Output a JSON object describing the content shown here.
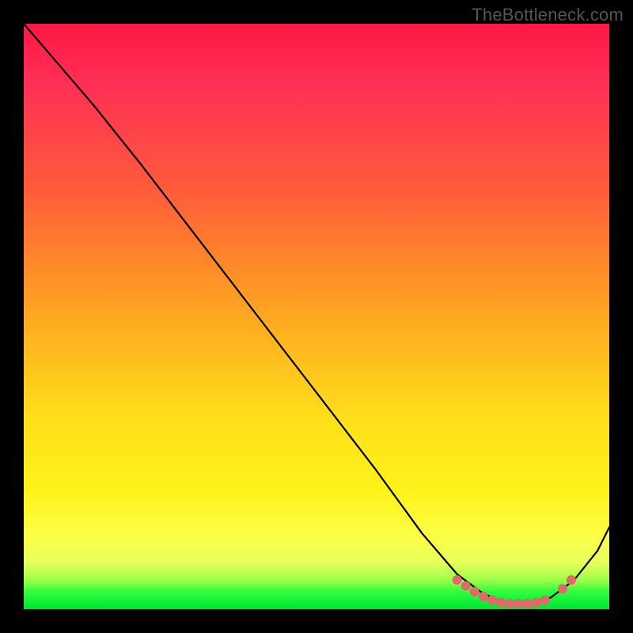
{
  "watermark": "TheBottleneck.com",
  "colors": {
    "dot": "#e06a6a",
    "curve": "#000000",
    "background": "#000000"
  },
  "chart_data": {
    "type": "line",
    "title": "",
    "xlabel": "",
    "ylabel": "",
    "xlim": [
      0,
      100
    ],
    "ylim": [
      0,
      100
    ],
    "grid": false,
    "legend": false,
    "series": [
      {
        "name": "bottleneck-curve",
        "x": [
          0,
          6,
          12,
          20,
          30,
          40,
          50,
          60,
          68,
          74,
          78,
          82,
          86,
          90,
          94,
          98,
          100
        ],
        "y": [
          100,
          93,
          86,
          76,
          63,
          50,
          37,
          24,
          13,
          6,
          3,
          1,
          1,
          2,
          5,
          10,
          14
        ]
      }
    ],
    "markers": [
      {
        "x": 74,
        "y": 5.0
      },
      {
        "x": 75.5,
        "y": 4.0
      },
      {
        "x": 77,
        "y": 3.0
      },
      {
        "x": 78.5,
        "y": 2.2
      },
      {
        "x": 80,
        "y": 1.6
      },
      {
        "x": 81.5,
        "y": 1.2
      },
      {
        "x": 83,
        "y": 1.0
      },
      {
        "x": 84.5,
        "y": 1.0
      },
      {
        "x": 86,
        "y": 1.0
      },
      {
        "x": 87.5,
        "y": 1.2
      },
      {
        "x": 89,
        "y": 1.6
      },
      {
        "x": 92,
        "y": 3.5
      },
      {
        "x": 93.5,
        "y": 5.0
      }
    ]
  }
}
